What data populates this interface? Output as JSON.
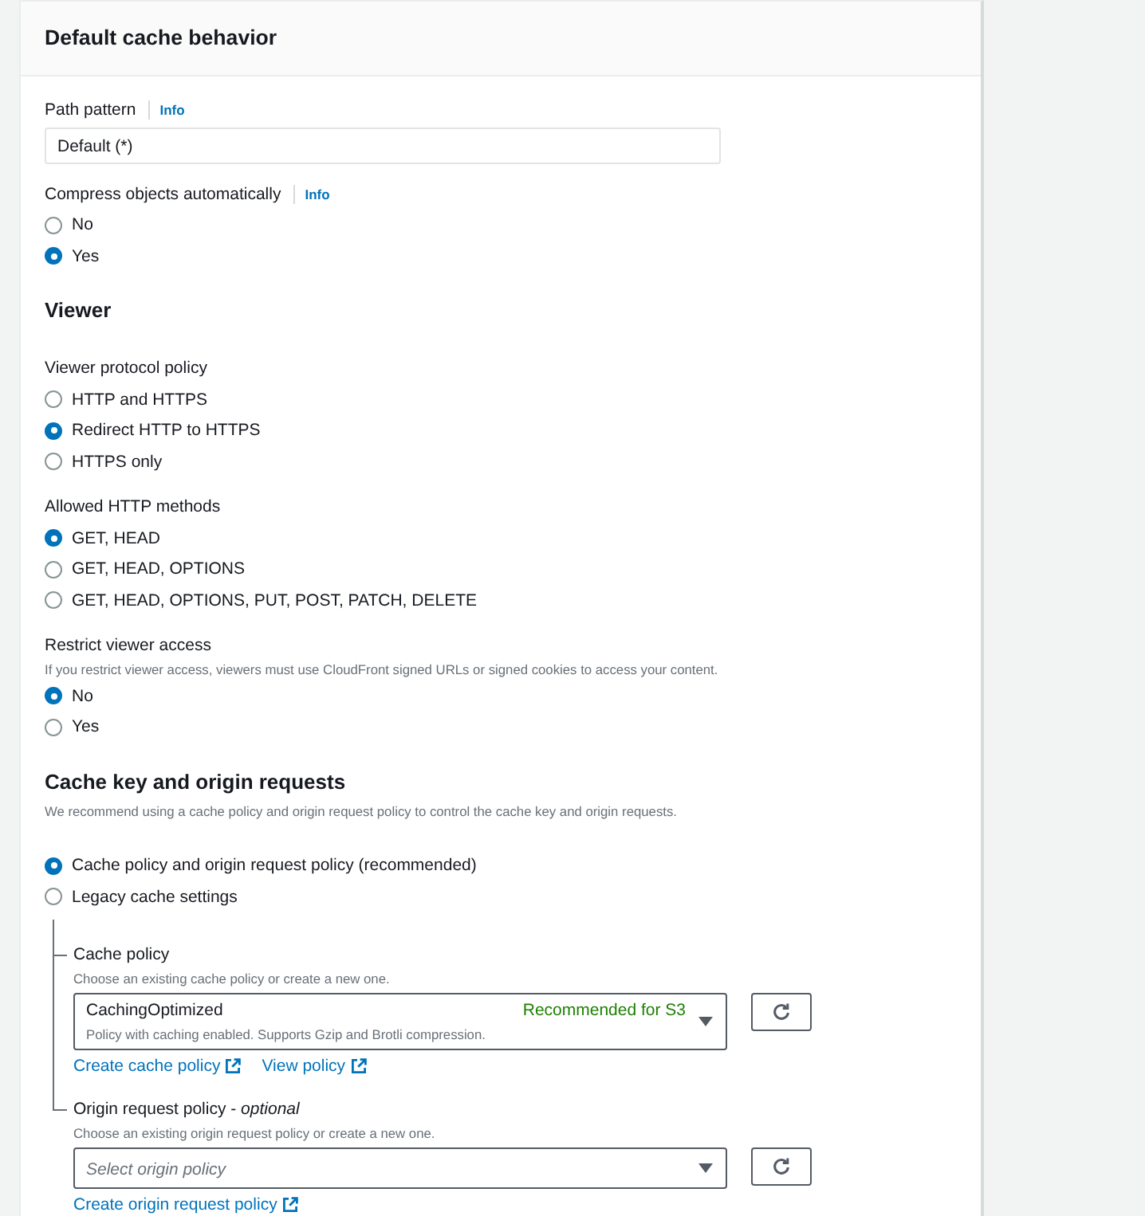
{
  "panel": {
    "title": "Default cache behavior"
  },
  "sections": [
    {
      "fields": [
        {
          "kind": "text",
          "label": "Path pattern",
          "info": "Info",
          "value": "Default (*)"
        },
        {
          "kind": "radio",
          "label": "Compress objects automatically",
          "info": "Info",
          "options": [
            {
              "label": "No",
              "selected": false
            },
            {
              "label": "Yes",
              "selected": true
            }
          ]
        }
      ]
    },
    {
      "heading": "Viewer",
      "fields": [
        {
          "kind": "radio",
          "label": "Viewer protocol policy",
          "options": [
            {
              "label": "HTTP and HTTPS",
              "selected": false
            },
            {
              "label": "Redirect HTTP to HTTPS",
              "selected": true
            },
            {
              "label": "HTTPS only",
              "selected": false
            }
          ]
        },
        {
          "kind": "radio",
          "label": "Allowed HTTP methods",
          "options": [
            {
              "label": "GET, HEAD",
              "selected": true
            },
            {
              "label": "GET, HEAD, OPTIONS",
              "selected": false
            },
            {
              "label": "GET, HEAD, OPTIONS, PUT, POST, PATCH, DELETE",
              "selected": false
            }
          ]
        },
        {
          "kind": "radio",
          "label": "Restrict viewer access",
          "description": "If you restrict viewer access, viewers must use CloudFront signed URLs or signed cookies to access your content.",
          "options": [
            {
              "label": "No",
              "selected": true
            },
            {
              "label": "Yes",
              "selected": false
            }
          ]
        }
      ]
    },
    {
      "heading": "Cache key and origin requests",
      "description": "We recommend using a cache policy and origin request policy to control the cache key and origin requests.",
      "fields": [
        {
          "kind": "radio",
          "options": [
            {
              "label": "Cache policy and origin request policy (recommended)",
              "selected": true
            },
            {
              "label": "Legacy cache settings",
              "selected": false
            }
          ]
        },
        {
          "kind": "tree",
          "children": [
            {
              "kind": "select",
              "label": "Cache policy",
              "description": "Choose an existing cache policy or create a new one.",
              "value": "CachingOptimized",
              "value_description": "Policy with caching enabled. Supports Gzip and Brotli compression.",
              "badge": "Recommended for S3",
              "links": [
                "Create cache policy",
                "View policy"
              ]
            },
            {
              "kind": "select",
              "label": "Origin request policy - *optional*",
              "description": "Choose an existing origin request policy or create a new one.",
              "placeholder": "Select origin policy",
              "links": [
                "Create origin request policy"
              ]
            }
          ]
        }
      ]
    }
  ]
}
